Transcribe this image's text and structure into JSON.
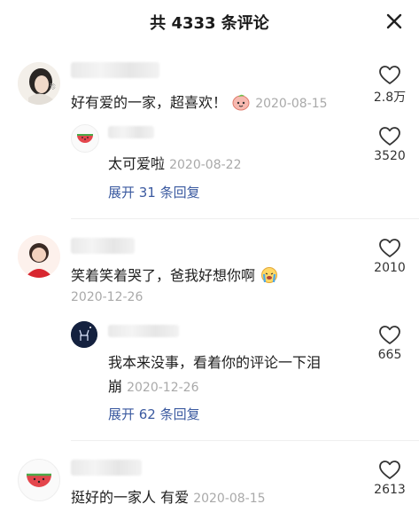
{
  "header": {
    "title": "共 4333 条评论"
  },
  "comments": [
    {
      "text": "好有爱的一家，超喜欢！",
      "date": "2020-08-15",
      "likes": "2.8万",
      "reply": {
        "text": "太可爱啦",
        "date": "2020-08-22",
        "likes": "3520"
      },
      "expand": "展开 31 条回复"
    },
    {
      "text": "笑着笑着哭了，爸我好想你啊",
      "date": "2020-12-26",
      "likes": "2010",
      "reply": {
        "text_line1": "我本来没事，看着你的评论一下泪",
        "text_line2": "崩",
        "date": "2020-12-26",
        "likes": "665"
      },
      "expand": "展开 62 条回复"
    },
    {
      "text": "挺好的一家人 有爱",
      "date": "2020-08-15",
      "likes": "2613"
    }
  ]
}
